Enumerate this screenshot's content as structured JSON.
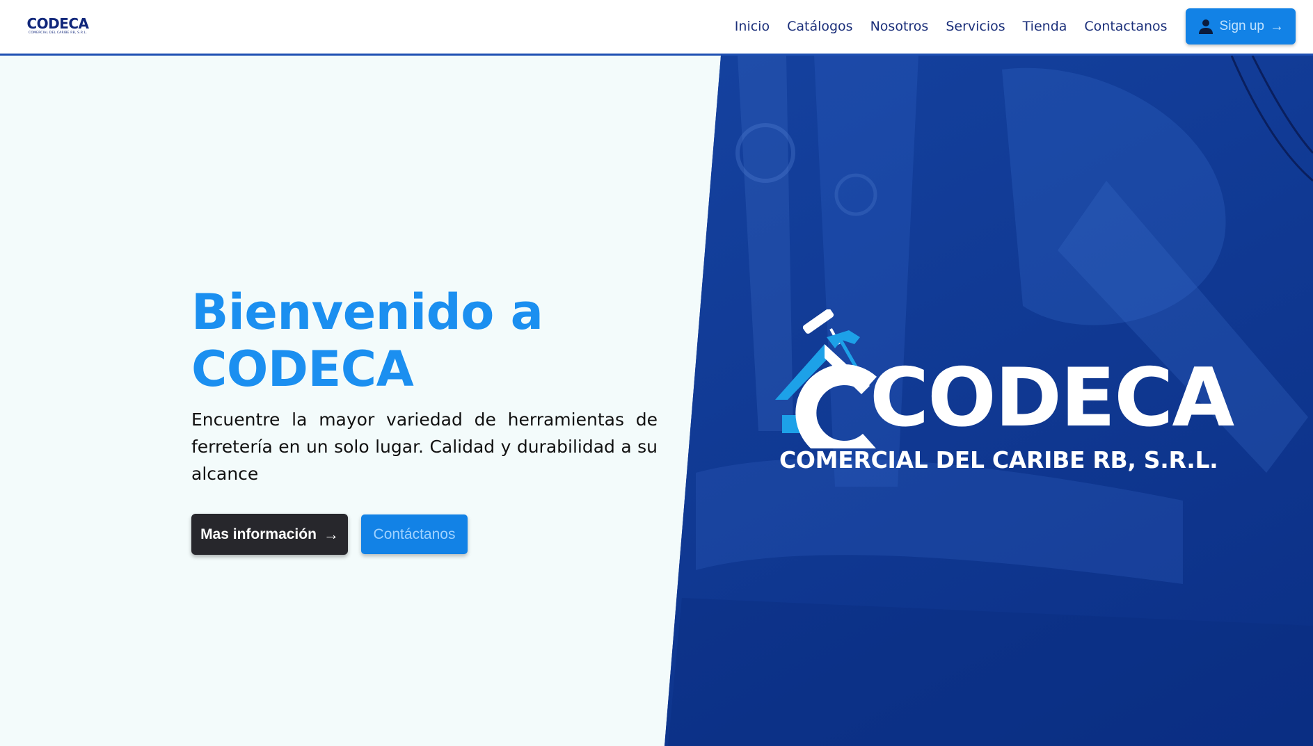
{
  "header": {
    "logo": {
      "word": "CODECA",
      "subtitle": "COMERCIAL DEL CARIBE RB, S.R.L."
    },
    "nav": [
      "Inicio",
      "Catálogos",
      "Nosotros",
      "Servicios",
      "Tienda",
      "Contactanos"
    ],
    "signup_label": "Sign up"
  },
  "hero": {
    "title_line1": "Bienvenido a",
    "title_line2": "CODECA",
    "description": "Encuentre la mayor variedad de herramientas de ferretería en un solo lugar. Calidad y durabilidad a su alcance",
    "btn_more": "Mas información",
    "btn_contact": "Contáctanos",
    "logo_word": "CODECA",
    "logo_subtitle": "COMERCIAL DEL CARIBE RB, S.R.L."
  },
  "colors": {
    "accent": "#1b8ff0",
    "button_primary": "#1282e6",
    "hero_panel": "#0e3a98",
    "nav_text": "#1b2f7a",
    "dark_button": "#27272c"
  },
  "icons": [
    "person-icon",
    "arrow-right-icon",
    "house-roof-icon",
    "paint-roller-icon",
    "hammer-icon"
  ]
}
